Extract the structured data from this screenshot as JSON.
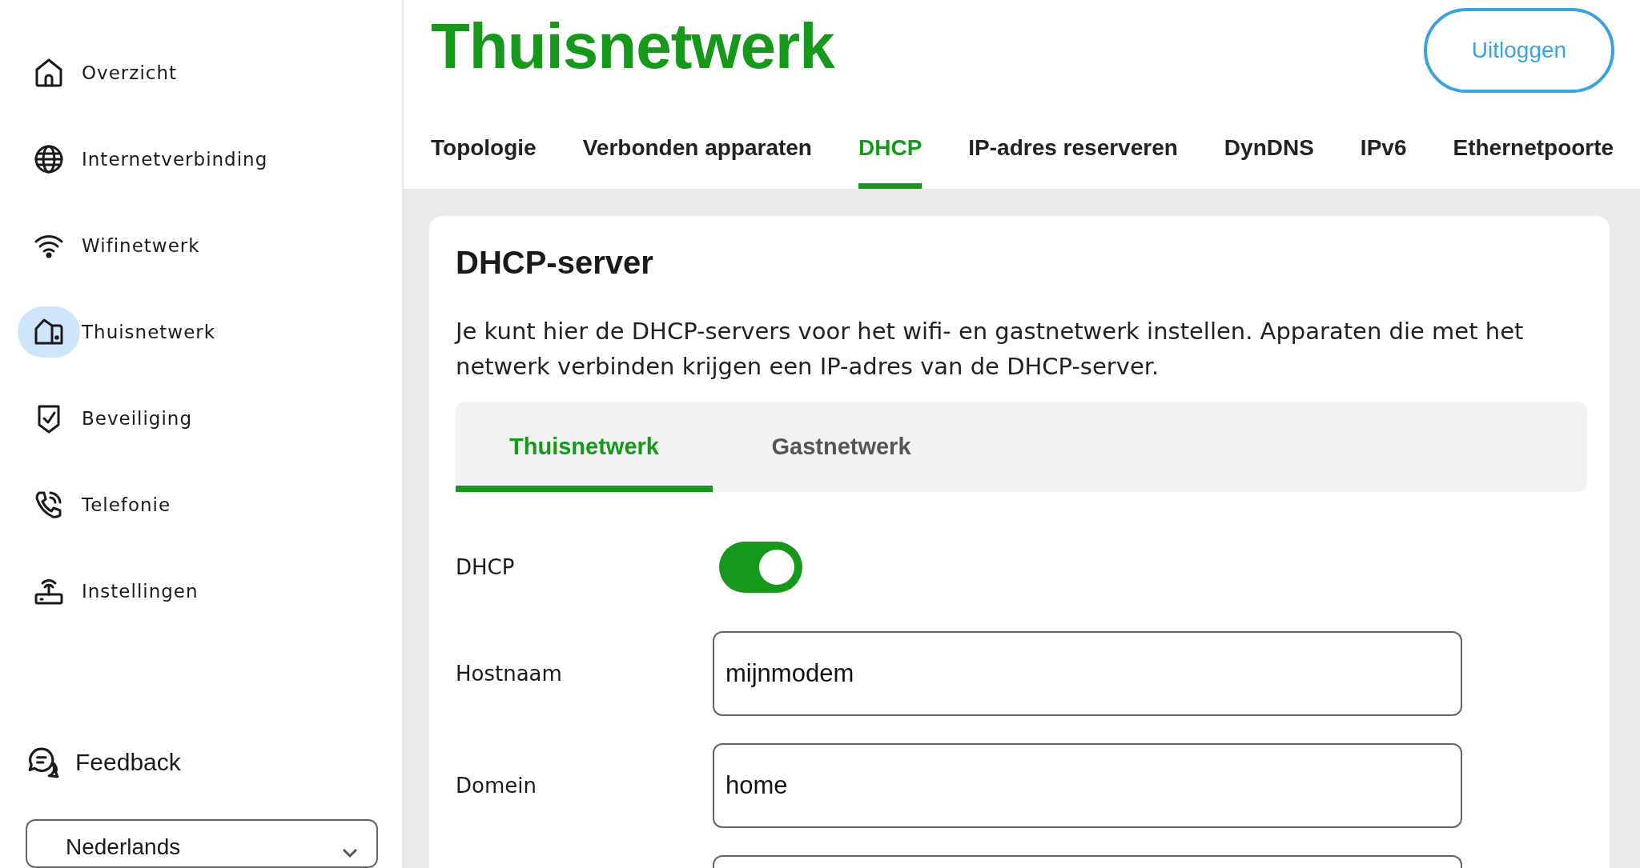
{
  "sidebar": {
    "items": [
      {
        "label": "Overzicht",
        "selected": false
      },
      {
        "label": "Internetverbinding",
        "selected": false
      },
      {
        "label": "Wifinetwerk",
        "selected": false
      },
      {
        "label": "Thuisnetwerk",
        "selected": true
      },
      {
        "label": "Beveiliging",
        "selected": false
      },
      {
        "label": "Telefonie",
        "selected": false
      },
      {
        "label": "Instellingen",
        "selected": false
      }
    ],
    "feedback": "Feedback",
    "language": {
      "value": "Nederlands"
    }
  },
  "header": {
    "title": "Thuisnetwerk",
    "logout": "Uitloggen"
  },
  "tabs": [
    {
      "label": "Topologie",
      "selected": false
    },
    {
      "label": "Verbonden apparaten",
      "selected": false
    },
    {
      "label": "DHCP",
      "selected": true
    },
    {
      "label": "IP-adres reserveren",
      "selected": false
    },
    {
      "label": "DynDNS",
      "selected": false
    },
    {
      "label": "IPv6",
      "selected": false
    },
    {
      "label": "Ethernetpoorte",
      "selected": false
    }
  ],
  "card": {
    "title": "DHCP-server",
    "description": "Je kunt hier de DHCP-servers voor het wifi- en gastnetwerk instellen. Apparaten die met het netwerk verbinden krijgen een IP-adres van de DHCP-server.",
    "subtabs": [
      {
        "label": "Thuisnetwerk",
        "selected": true
      },
      {
        "label": "Gastnetwerk",
        "selected": false
      }
    ],
    "fields": [
      {
        "kind": "toggle",
        "label": "DHCP",
        "on": true
      },
      {
        "kind": "text",
        "label": "Hostnaam",
        "value": "mijnmodem"
      },
      {
        "kind": "text",
        "label": "Domein",
        "value": "home"
      },
      {
        "kind": "text"
      }
    ]
  }
}
